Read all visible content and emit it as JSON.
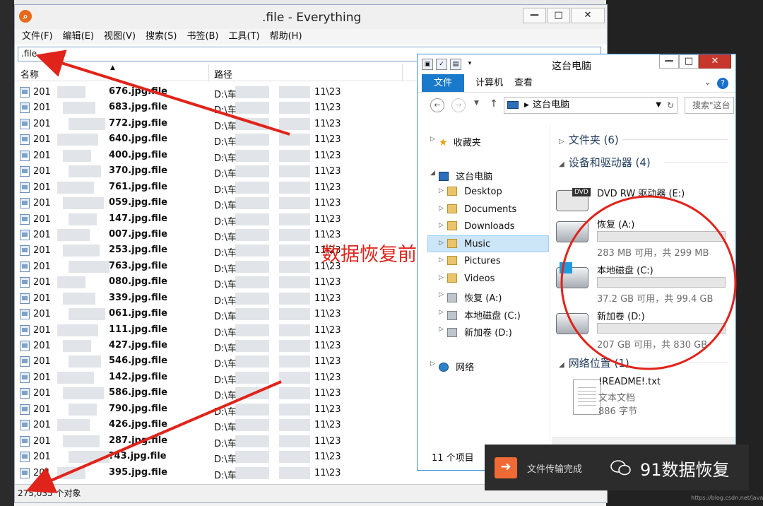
{
  "everything": {
    "title": ".file - Everything",
    "logo": "magnifier-logo",
    "menu": [
      "文件(F)",
      "编辑(E)",
      "视图(V)",
      "搜索(S)",
      "书签(B)",
      "工具(T)",
      "帮助(H)"
    ],
    "search_value": ".file",
    "columns": {
      "name": "名称",
      "path": "路径"
    },
    "rows": [
      {
        "prefix": "201",
        "name": "676.jpg.file",
        "path_a": "D:\\车",
        "path_b": "11\\23"
      },
      {
        "prefix": "201",
        "name": "683.jpg.file",
        "path_a": "D:\\车",
        "path_b": "11\\23"
      },
      {
        "prefix": "201",
        "name": "772.jpg.file",
        "path_a": "D:\\车",
        "path_b": "11\\23"
      },
      {
        "prefix": "201",
        "name": "640.jpg.file",
        "path_a": "D:\\车",
        "path_b": "11\\23"
      },
      {
        "prefix": "201",
        "name": "400.jpg.file",
        "path_a": "D:\\车",
        "path_b": "11\\23"
      },
      {
        "prefix": "201",
        "name": "370.jpg.file",
        "path_a": "D:\\车",
        "path_b": "11\\23"
      },
      {
        "prefix": "201",
        "name": "761.jpg.file",
        "path_a": "D:\\车",
        "path_b": "11\\23"
      },
      {
        "prefix": "201",
        "name": "059.jpg.file",
        "path_a": "D:\\车",
        "path_b": "11\\23"
      },
      {
        "prefix": "201",
        "name": "147.jpg.file",
        "path_a": "D:\\车",
        "path_b": "11\\23"
      },
      {
        "prefix": "201",
        "name": "007.jpg.file",
        "path_a": "D:\\车",
        "path_b": "11\\23"
      },
      {
        "prefix": "201",
        "name": "253.jpg.file",
        "path_a": "D:\\车",
        "path_b": "11\\23"
      },
      {
        "prefix": "201",
        "name": "763.jpg.file",
        "path_a": "D:\\车",
        "path_b": "11\\23"
      },
      {
        "prefix": "201",
        "name": "080.jpg.file",
        "path_a": "D:\\车",
        "path_b": "11\\23"
      },
      {
        "prefix": "201",
        "name": "339.jpg.file",
        "path_a": "D:\\车",
        "path_b": "11\\23"
      },
      {
        "prefix": "201",
        "name": "061.jpg.file",
        "path_a": "D:\\车",
        "path_b": "11\\23"
      },
      {
        "prefix": "201",
        "name": "111.jpg.file",
        "path_a": "D:\\车",
        "path_b": "11\\23"
      },
      {
        "prefix": "201",
        "name": "427.jpg.file",
        "path_a": "D:\\车",
        "path_b": "11\\23"
      },
      {
        "prefix": "201",
        "name": "546.jpg.file",
        "path_a": "D:\\车",
        "path_b": "11\\23"
      },
      {
        "prefix": "201",
        "name": "142.jpg.file",
        "path_a": "D:\\车",
        "path_b": "11\\23"
      },
      {
        "prefix": "201",
        "name": "586.jpg.file",
        "path_a": "D:\\车",
        "path_b": "11\\23"
      },
      {
        "prefix": "201",
        "name": "790.jpg.file",
        "path_a": "D:\\车",
        "path_b": "11\\23"
      },
      {
        "prefix": "201",
        "name": "426.jpg.file",
        "path_a": "D:\\车",
        "path_b": "11\\23"
      },
      {
        "prefix": "201",
        "name": "287.jpg.file",
        "path_a": "D:\\车",
        "path_b": "11\\23"
      },
      {
        "prefix": "201",
        "name": "?43.jpg.file",
        "path_a": "D:\\车",
        "path_b": "11\\23"
      },
      {
        "prefix": "201",
        "name": "395.jpg.file",
        "path_a": "D:\\车",
        "path_b": "11\\23"
      }
    ],
    "status": "275,035 个对象"
  },
  "explorer": {
    "title": "这台电脑",
    "ribbon": {
      "file": "文件",
      "computer": "计算机",
      "view": "查看",
      "help": "?"
    },
    "address": "这台电脑",
    "search_placeholder": "搜索\"这台",
    "tree": {
      "favorites": "收藏夹",
      "this_pc": "这台电脑",
      "children": [
        "Desktop",
        "Documents",
        "Downloads",
        "Music",
        "Pictures",
        "Videos",
        "恢复 (A:)",
        "本地磁盘 (C:)",
        "新加卷 (D:)"
      ],
      "network": "网络"
    },
    "groups": {
      "folders": "文件夹 (6)",
      "devices": "设备和驱动器 (4)",
      "network": "网络位置 (1)"
    },
    "drives": [
      {
        "name": "DVD RW 驱动器 (E:)",
        "size": "",
        "used_fraction": null,
        "dvd_badge": "DVD"
      },
      {
        "name": "恢复 (A:)",
        "size": "283 MB 可用，共 299 MB",
        "used_fraction": 0.054
      },
      {
        "name": "本地磁盘 (C:)",
        "size": "37.2 GB 可用，共 99.4 GB",
        "used_fraction": 0.626
      },
      {
        "name": "新加卷 (D:)",
        "size": "207 GB 可用，共 830 GB",
        "used_fraction": 0.75
      }
    ],
    "network_item": {
      "name": "!README!.txt",
      "type": "文本文档",
      "size": "886 字节"
    },
    "status": "11 个项目"
  },
  "annotation": {
    "text": "数据恢复前",
    "color": "#e0241b"
  },
  "notification": {
    "text": "文件传输完成",
    "brand": "91数据恢复"
  },
  "watermark": "https://blog.csdn.net/javaFay",
  "colors": {
    "accent": "#1979ca",
    "drive_bar": "#26a0da",
    "annotation": "#e0241b"
  }
}
